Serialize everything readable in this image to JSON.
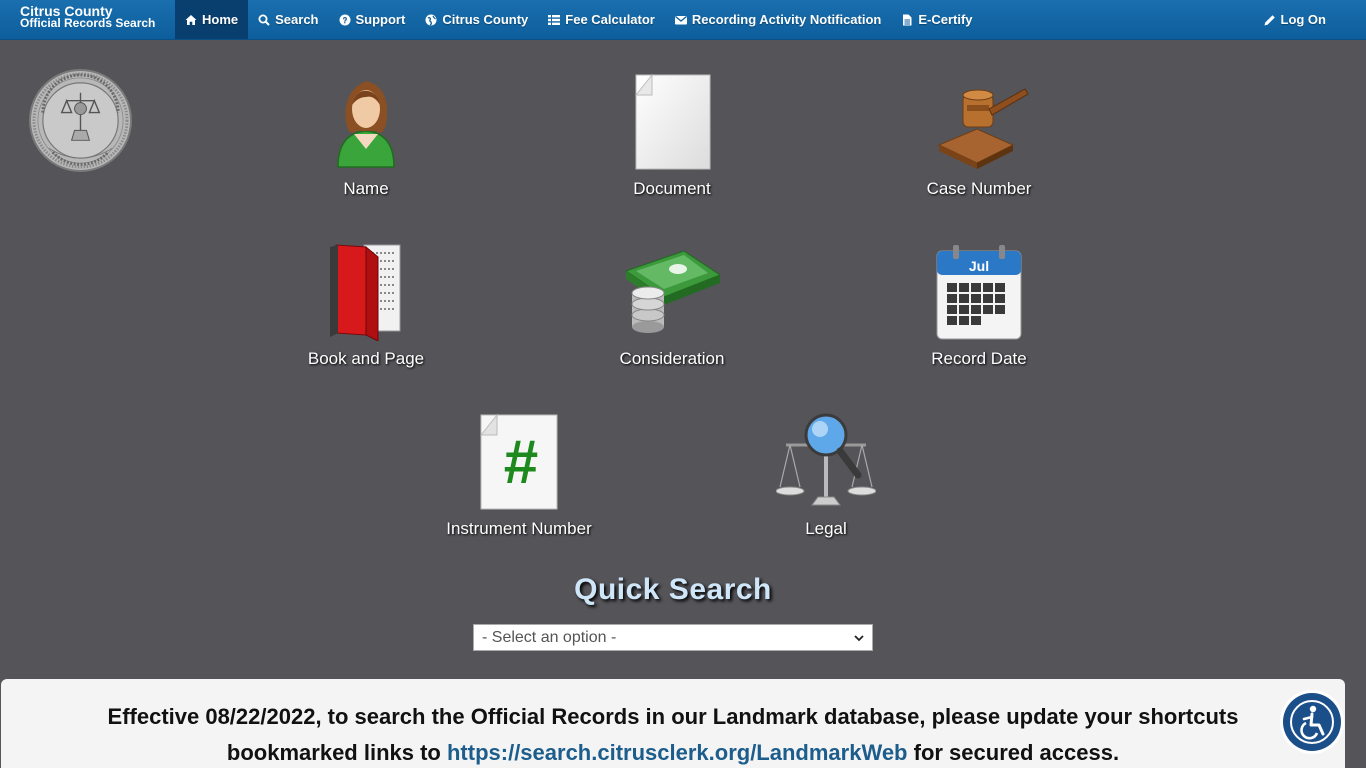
{
  "brand": {
    "line1": "Citrus County",
    "line2": "Official Records Search"
  },
  "nav": {
    "home": "Home",
    "search": "Search",
    "support": "Support",
    "citrus": "Citrus County",
    "fee": "Fee Calculator",
    "recording": "Recording Activity Notification",
    "ecertify": "E-Certify",
    "logon": "Log On"
  },
  "tiles": {
    "name": "Name",
    "document": "Document",
    "case_number": "Case Number",
    "book_page": "Book and Page",
    "consideration": "Consideration",
    "record_date": "Record Date",
    "instrument": "Instrument Number",
    "legal": "Legal"
  },
  "calendar_month": "Jul",
  "quick_search": {
    "title": "Quick Search",
    "selected": "- Select an option -"
  },
  "notice": {
    "line1": "Effective 08/22/2022, to search the Official Records in our Landmark database, please update your shortcuts",
    "pre": "bookmarked links to ",
    "link": "https://search.citrusclerk.org/LandmarkWeb",
    "post": " for secured access."
  },
  "colors": {
    "navbar": "#0d5e9c",
    "background": "#545459",
    "quick_search_title": "#cfe6f8",
    "link": "#1c5d8c"
  }
}
